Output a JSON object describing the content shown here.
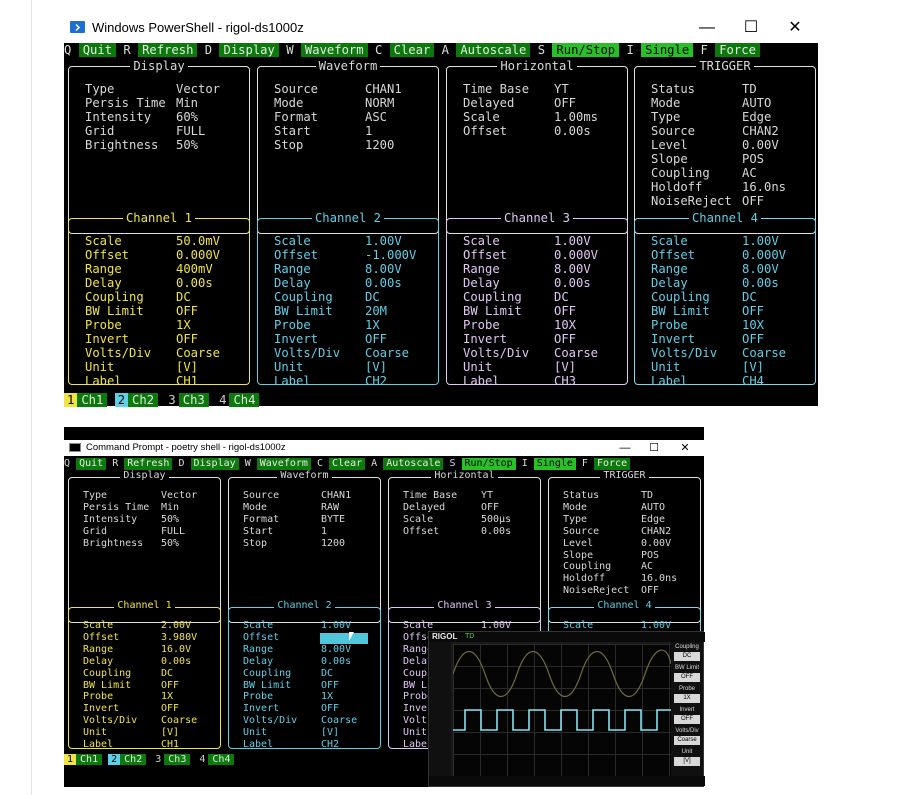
{
  "powershell": {
    "title": "Windows PowerShell - rigol-ds1000z",
    "win_controls": [
      "—",
      "☐",
      "✕"
    ],
    "menu": [
      {
        "key": "Q",
        "label": "Quit"
      },
      {
        "key": "R",
        "label": "Refresh"
      },
      {
        "key": "D",
        "label": "Display"
      },
      {
        "key": "W",
        "label": "Waveform"
      },
      {
        "key": "C",
        "label": "Clear"
      },
      {
        "key": "A",
        "label": "Autoscale"
      },
      {
        "key": "S",
        "label": "Run/Stop"
      },
      {
        "key": "I",
        "label": "Single"
      },
      {
        "key": "F",
        "label": "Force"
      }
    ],
    "display": {
      "title": "Display",
      "rows": [
        {
          "k": "Type",
          "v": "Vector"
        },
        {
          "k": "Persis Time",
          "v": "Min"
        },
        {
          "k": "Intensity",
          "v": "60%"
        },
        {
          "k": "Grid",
          "v": "FULL"
        },
        {
          "k": "Brightness",
          "v": "50%"
        }
      ]
    },
    "waveform": {
      "title": "Waveform",
      "rows": [
        {
          "k": "Source",
          "v": "CHAN1"
        },
        {
          "k": "Mode",
          "v": "NORM"
        },
        {
          "k": "Format",
          "v": "ASC"
        },
        {
          "k": "Start",
          "v": "1"
        },
        {
          "k": "Stop",
          "v": "1200"
        }
      ]
    },
    "horizontal": {
      "title": "Horizontal",
      "rows": [
        {
          "k": "Time Base",
          "v": "YT"
        },
        {
          "k": "Delayed",
          "v": "OFF"
        },
        {
          "k": "Scale",
          "v": "1.00ms"
        },
        {
          "k": "Offset",
          "v": "0.00s"
        }
      ]
    },
    "trigger": {
      "title": "TRIGGER",
      "rows": [
        {
          "k": "Status",
          "v": "TD"
        },
        {
          "k": "Mode",
          "v": "AUTO"
        },
        {
          "k": "Type",
          "v": "Edge"
        },
        {
          "k": "Source",
          "v": "CHAN2"
        },
        {
          "k": "Level",
          "v": "0.00V"
        },
        {
          "k": "Slope",
          "v": "POS"
        },
        {
          "k": "Coupling",
          "v": "AC"
        },
        {
          "k": "Holdoff",
          "v": "16.0ns"
        },
        {
          "k": "NoiseReject",
          "v": "OFF"
        }
      ]
    },
    "channels": [
      {
        "title": "Channel 1",
        "rows": [
          {
            "k": "Scale",
            "v": "50.0mV"
          },
          {
            "k": "Offset",
            "v": "0.000V"
          },
          {
            "k": "Range",
            "v": "400mV"
          },
          {
            "k": "Delay",
            "v": "0.00s"
          },
          {
            "k": "Coupling",
            "v": "DC"
          },
          {
            "k": "BW Limit",
            "v": "OFF"
          },
          {
            "k": "Probe",
            "v": "1X"
          },
          {
            "k": "Invert",
            "v": "OFF"
          },
          {
            "k": "Volts/Div",
            "v": "Coarse"
          },
          {
            "k": "Unit",
            "v": "[V]"
          },
          {
            "k": "Label",
            "v": "CH1"
          }
        ]
      },
      {
        "title": "Channel 2",
        "rows": [
          {
            "k": "Scale",
            "v": "1.00V"
          },
          {
            "k": "Offset",
            "v": "-1.000V"
          },
          {
            "k": "Range",
            "v": "8.00V"
          },
          {
            "k": "Delay",
            "v": "0.00s"
          },
          {
            "k": "Coupling",
            "v": "DC"
          },
          {
            "k": "BW Limit",
            "v": "20M"
          },
          {
            "k": "Probe",
            "v": "1X"
          },
          {
            "k": "Invert",
            "v": "OFF"
          },
          {
            "k": "Volts/Div",
            "v": "Coarse"
          },
          {
            "k": "Unit",
            "v": "[V]"
          },
          {
            "k": "Label",
            "v": "CH2"
          }
        ]
      },
      {
        "title": "Channel 3",
        "rows": [
          {
            "k": "Scale",
            "v": "1.00V"
          },
          {
            "k": "Offset",
            "v": "0.000V"
          },
          {
            "k": "Range",
            "v": "8.00V"
          },
          {
            "k": "Delay",
            "v": "0.00s"
          },
          {
            "k": "Coupling",
            "v": "DC"
          },
          {
            "k": "BW Limit",
            "v": "OFF"
          },
          {
            "k": "Probe",
            "v": "10X"
          },
          {
            "k": "Invert",
            "v": "OFF"
          },
          {
            "k": "Volts/Div",
            "v": "Coarse"
          },
          {
            "k": "Unit",
            "v": "[V]"
          },
          {
            "k": "Label",
            "v": "CH3"
          }
        ]
      },
      {
        "title": "Channel 4",
        "rows": [
          {
            "k": "Scale",
            "v": "1.00V"
          },
          {
            "k": "Offset",
            "v": "0.000V"
          },
          {
            "k": "Range",
            "v": "8.00V"
          },
          {
            "k": "Delay",
            "v": "0.00s"
          },
          {
            "k": "Coupling",
            "v": "DC"
          },
          {
            "k": "BW Limit",
            "v": "OFF"
          },
          {
            "k": "Probe",
            "v": "10X"
          },
          {
            "k": "Invert",
            "v": "OFF"
          },
          {
            "k": "Volts/Div",
            "v": "Coarse"
          },
          {
            "k": "Unit",
            "v": "[V]"
          },
          {
            "k": "Label",
            "v": "CH4"
          }
        ]
      }
    ],
    "footer": [
      {
        "n": "1",
        "label": "Ch1"
      },
      {
        "n": "2",
        "label": "Ch2"
      },
      {
        "n": "3",
        "label": "Ch3"
      },
      {
        "n": "4",
        "label": "Ch4"
      }
    ]
  },
  "cmd": {
    "title": "Command Prompt - poetry  shell - rigol-ds1000z",
    "win_controls": [
      "—",
      "☐",
      "✕"
    ],
    "menu": [
      {
        "key": "Q",
        "label": "Quit"
      },
      {
        "key": "R",
        "label": "Refresh"
      },
      {
        "key": "D",
        "label": "Display"
      },
      {
        "key": "W",
        "label": "Waveform"
      },
      {
        "key": "C",
        "label": "Clear"
      },
      {
        "key": "A",
        "label": "Autoscale"
      },
      {
        "key": "S",
        "label": "Run/Stop"
      },
      {
        "key": "I",
        "label": "Single"
      },
      {
        "key": "F",
        "label": "Force"
      }
    ],
    "display": {
      "title": "Display",
      "rows": [
        {
          "k": "Type",
          "v": "Vector"
        },
        {
          "k": "Persis Time",
          "v": "Min"
        },
        {
          "k": "Intensity",
          "v": "50%"
        },
        {
          "k": "Grid",
          "v": "FULL"
        },
        {
          "k": "Brightness",
          "v": "50%"
        }
      ]
    },
    "waveform": {
      "title": "Waveform",
      "rows": [
        {
          "k": "Source",
          "v": "CHAN1"
        },
        {
          "k": "Mode",
          "v": "RAW"
        },
        {
          "k": "Format",
          "v": "BYTE"
        },
        {
          "k": "Start",
          "v": "1"
        },
        {
          "k": "Stop",
          "v": "1200"
        }
      ]
    },
    "horizontal": {
      "title": "Horizontal",
      "rows": [
        {
          "k": "Time Base",
          "v": "YT"
        },
        {
          "k": "Delayed",
          "v": "OFF"
        },
        {
          "k": "Scale",
          "v": "500µs"
        },
        {
          "k": "Offset",
          "v": "0.00s"
        }
      ]
    },
    "trigger": {
      "title": "TRIGGER",
      "rows": [
        {
          "k": "Status",
          "v": "TD"
        },
        {
          "k": "Mode",
          "v": "AUTO"
        },
        {
          "k": "Type",
          "v": "Edge"
        },
        {
          "k": "Source",
          "v": "CHAN2"
        },
        {
          "k": "Level",
          "v": "0.00V"
        },
        {
          "k": "Slope",
          "v": "POS"
        },
        {
          "k": "Coupling",
          "v": "AC"
        },
        {
          "k": "Holdoff",
          "v": "16.0ns"
        },
        {
          "k": "NoiseReject",
          "v": "OFF"
        }
      ]
    },
    "channels": [
      {
        "title": "Channel 1",
        "rows": [
          {
            "k": "Scale",
            "v": "2.00V"
          },
          {
            "k": "Offset",
            "v": "3.980V"
          },
          {
            "k": "Range",
            "v": "16.0V"
          },
          {
            "k": "Delay",
            "v": "0.00s"
          },
          {
            "k": "Coupling",
            "v": "DC"
          },
          {
            "k": "BW Limit",
            "v": "OFF"
          },
          {
            "k": "Probe",
            "v": "1X"
          },
          {
            "k": "Invert",
            "v": "OFF"
          },
          {
            "k": "Volts/Div",
            "v": "Coarse"
          },
          {
            "k": "Unit",
            "v": "[V]"
          },
          {
            "k": "Label",
            "v": "CH1"
          }
        ]
      },
      {
        "title": "Channel 2",
        "rows": [
          {
            "k": "Scale",
            "v": "1.00V"
          },
          {
            "k": "Offset",
            "v": ""
          },
          {
            "k": "Range",
            "v": "8.00V"
          },
          {
            "k": "Delay",
            "v": "0.00s"
          },
          {
            "k": "Coupling",
            "v": "DC"
          },
          {
            "k": "BW Limit",
            "v": "OFF"
          },
          {
            "k": "Probe",
            "v": "1X"
          },
          {
            "k": "Invert",
            "v": "OFF"
          },
          {
            "k": "Volts/Div",
            "v": "Coarse"
          },
          {
            "k": "Unit",
            "v": "[V]"
          },
          {
            "k": "Label",
            "v": "CH2"
          }
        ]
      },
      {
        "title": "Channel 3",
        "rows": [
          {
            "k": "Scale",
            "v": "1.00V"
          },
          {
            "k": "Offset",
            "v": ""
          },
          {
            "k": "Range",
            "v": ""
          },
          {
            "k": "Delay",
            "v": ""
          },
          {
            "k": "Coupling",
            "v": ""
          },
          {
            "k": "BW Limit",
            "v": ""
          },
          {
            "k": "Probe",
            "v": ""
          },
          {
            "k": "Invert",
            "v": ""
          },
          {
            "k": "Volts/Div",
            "v": ""
          },
          {
            "k": "Unit",
            "v": ""
          },
          {
            "k": "Label",
            "v": ""
          }
        ]
      },
      {
        "title": "Channel 4",
        "rows": [
          {
            "k": "Scale",
            "v": "1.00V"
          }
        ]
      }
    ],
    "footer": [
      {
        "n": "1",
        "label": "Ch1"
      },
      {
        "n": "2",
        "label": "Ch2"
      },
      {
        "n": "3",
        "label": "Ch3"
      },
      {
        "n": "4",
        "label": "Ch4"
      }
    ]
  },
  "scope_overlay": {
    "brand": "RIGOL",
    "status": "TD",
    "right_menu": [
      {
        "heading": "Coupling",
        "value": "DC"
      },
      {
        "heading": "BW Limit",
        "value": "OFF"
      },
      {
        "heading": "Probe",
        "value": "1X"
      },
      {
        "heading": "Invert",
        "value": "OFF"
      },
      {
        "heading": "Volts/Div",
        "value": "Coarse"
      },
      {
        "heading": "Unit",
        "value": "[V]"
      }
    ],
    "colors": {
      "ch1": "#f0e442",
      "ch2": "#5fd0e8",
      "ch3": "#e0c6f2",
      "ch4": "#4a7cff"
    }
  },
  "colors": {
    "ch1": "#f0e442",
    "ch2": "#5fd0e8",
    "ch3": "#e0c6f2",
    "ch4": "#7fd8ef",
    "menu_green": "#0b7a0b",
    "menu_green_hi": "#27c027",
    "terminal_bg": "#000000"
  }
}
